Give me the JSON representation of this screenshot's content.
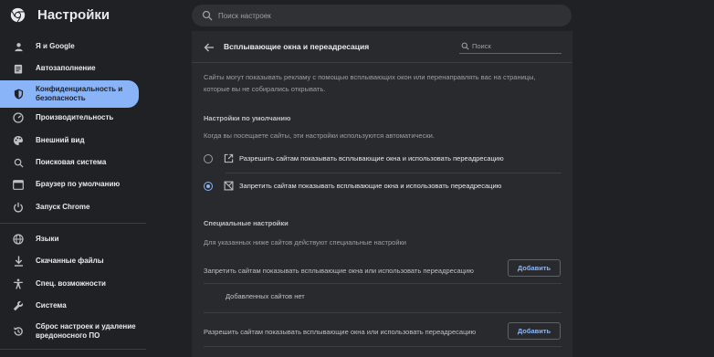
{
  "header": {
    "app_title": "Настройки",
    "search_placeholder": "Поиск настроек",
    "logo_icon": "chrome-logo-icon"
  },
  "sidebar": {
    "items": [
      {
        "label": "Я и Google",
        "icon": "person-icon",
        "active": false
      },
      {
        "label": "Автозаполнение",
        "icon": "clipboard-icon",
        "active": false
      },
      {
        "label": "Конфиденциальность и безопасность",
        "icon": "shield-icon",
        "active": true
      },
      {
        "label": "Производительность",
        "icon": "speedometer-icon",
        "active": false
      },
      {
        "label": "Внешний вид",
        "icon": "palette-icon",
        "active": false
      },
      {
        "label": "Поисковая система",
        "icon": "search-icon",
        "active": false
      },
      {
        "label": "Браузер по умолчанию",
        "icon": "browser-window-icon",
        "active": false
      },
      {
        "label": "Запуск Chrome",
        "icon": "power-icon",
        "active": false
      },
      {
        "label": "Языки",
        "icon": "globe-icon",
        "active": false
      },
      {
        "label": "Скачанные файлы",
        "icon": "download-icon",
        "active": false
      },
      {
        "label": "Спец. возможности",
        "icon": "accessibility-icon",
        "active": false
      },
      {
        "label": "Система",
        "icon": "wrench-icon",
        "active": false
      },
      {
        "label": "Сброс настроек и удаление вредоносного ПО",
        "icon": "reset-icon",
        "active": false
      }
    ]
  },
  "main": {
    "title": "Всплывающие окна и переадресация",
    "search_placeholder": "Поиск",
    "intro": "Сайты могут показывать рекламу с помощью всплывающих окон или перенаправлять вас на страницы, которые вы не собирались открывать.",
    "default_heading": "Настройки по умолчанию",
    "default_desc": "Когда вы посещаете сайты, эти настройки используются автоматически.",
    "options": [
      {
        "label": "Разрешить сайтам показывать всплывающие окна и использовать переадресацию",
        "icon": "open-in-new-icon",
        "selected": false
      },
      {
        "label": "Запретить сайтам показывать всплывающие окна и использовать переадресацию",
        "icon": "popup-blocked-icon",
        "selected": true
      }
    ],
    "custom_heading": "Специальные настройки",
    "custom_desc": "Для указанных ниже сайтов действуют специальные настройки",
    "block_label": "Запретить сайтам показывать всплывающие окна или использовать переадресацию",
    "allow_label": "Разрешить сайтам показывать всплывающие окна или использовать переадресацию",
    "add_label": "Добавить",
    "empty_label": "Добавленных сайтов нет"
  },
  "colors": {
    "background": "#202124",
    "card": "#292a2d",
    "accent": "#8ab4f8",
    "text": "#e8eaed",
    "secondary_text": "#9aa0a6"
  }
}
